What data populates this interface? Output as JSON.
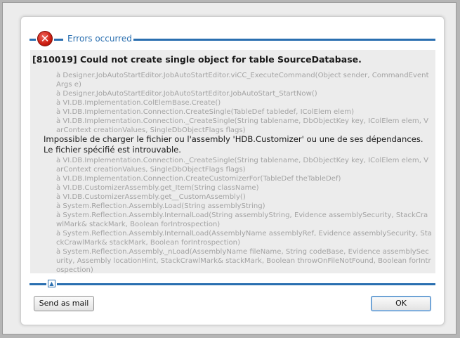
{
  "dialog": {
    "title": "Errors occurred",
    "icon": "error-icon",
    "accent_color": "#2a6fb0"
  },
  "error": {
    "headline": "[810019] Could not create single object for table SourceDatabase.",
    "trace_before": "à Designer.JobAutoStartEditor.JobAutoStartEditor.viCC_ExecuteCommand(Object sender, CommandEventArgs e)\nà Designer.JobAutoStartEditor.JobAutoStartEditor.JobAutoStart_StartNow()\nà VI.DB.Implementation.ColElemBase.Create()\nà VI.DB.Implementation.Connection.CreateSingle(TableDef tabledef, IColElem elem)\nà VI.DB.Implementation.Connection._CreateSingle(String tablename, DbObjectKey key, IColElem elem, VarContext creationValues, SingleDbObjectFlags flags)",
    "inner_message": "Impossible de charger le fichier ou l'assembly 'HDB.Customizer' ou une de ses dépendances. Le fichier spécifié est introuvable.",
    "trace_after": "à VI.DB.Implementation.Connection._CreateSingle(String tablename, DbObjectKey key, IColElem elem, VarContext creationValues, SingleDbObjectFlags flags)\nà VI.DB.Implementation.Connection.CreateCustomizerFor(TableDef theTableDef)\nà VI.DB.CustomizerAssembly.get_Item(String className)\nà VI.DB.CustomizerAssembly.get__CustomAssembly()\nà System.Reflection.Assembly.Load(String assemblyString)\nà System.Reflection.Assembly.InternalLoad(String assemblyString, Evidence assemblySecurity, StackCrawlMark& stackMark, Boolean forIntrospection)\nà System.Reflection.Assembly.InternalLoad(AssemblyName assemblyRef, Evidence assemblySecurity, StackCrawlMark& stackMark, Boolean forIntrospection)\nà System.Reflection.Assembly._nLoad(AssemblyName fileName, String codeBase, Evidence assemblySecurity, Assembly locationHint, StackCrawlMark& stackMark, Boolean throwOnFileNotFound, Boolean forIntrospection)"
  },
  "buttons": {
    "send_mail": "Send as mail",
    "ok": "OK"
  }
}
